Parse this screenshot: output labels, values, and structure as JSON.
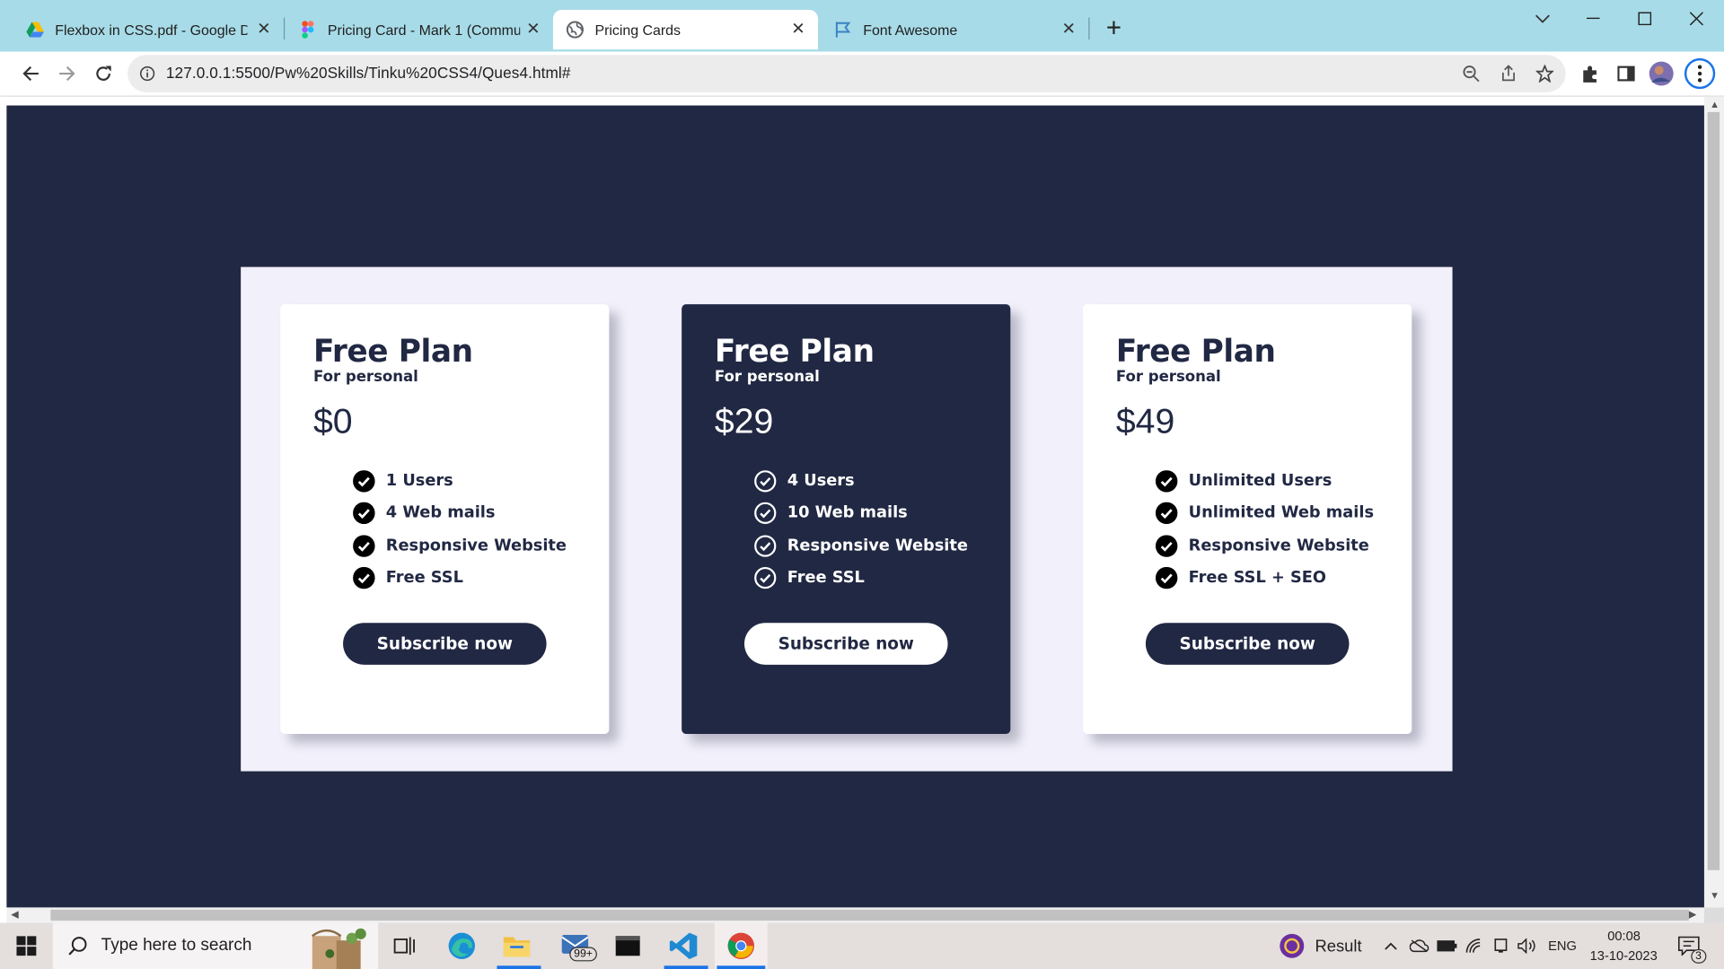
{
  "browser": {
    "tabs": [
      {
        "title": "Flexbox in CSS.pdf - Google Drive",
        "icon": "google-drive-icon",
        "active": false
      },
      {
        "title": "Pricing Card - Mark 1 (Community)",
        "icon": "figma-icon",
        "active": false
      },
      {
        "title": "Pricing Cards",
        "icon": "globe-icon",
        "active": true
      },
      {
        "title": "Font Awesome",
        "icon": "font-awesome-flag-icon",
        "active": false
      }
    ],
    "url": "127.0.0.1:5500/Pw%20Skills/Tinku%20CSS4/Ques4.html#"
  },
  "page": {
    "background": "#212843",
    "panel_background": "#f2f1fb",
    "cards": [
      {
        "theme": "light",
        "title": "Free Plan",
        "subtitle": "For personal",
        "price": "$0",
        "features": [
          "1 Users",
          "4 Web mails",
          "Responsive Website",
          "Free SSL"
        ],
        "button": "Subscribe now"
      },
      {
        "theme": "dark",
        "title": "Free Plan",
        "subtitle": "For personal",
        "price": "$29",
        "features": [
          "4 Users",
          "10 Web mails",
          "Responsive Website",
          "Free SSL"
        ],
        "button": "Subscribe now"
      },
      {
        "theme": "light",
        "title": "Free Plan",
        "subtitle": "For personal",
        "price": "$49",
        "features": [
          "Unlimited Users",
          "Unlimited Web mails",
          "Responsive Website",
          "Free SSL + SEO"
        ],
        "button": "Subscribe now"
      }
    ]
  },
  "taskbar": {
    "search_placeholder": "Type here to search",
    "mail_badge": "99+",
    "result_label": "Result",
    "language": "ENG",
    "time": "00:08",
    "date": "13-10-2023",
    "notification_count": "3"
  }
}
